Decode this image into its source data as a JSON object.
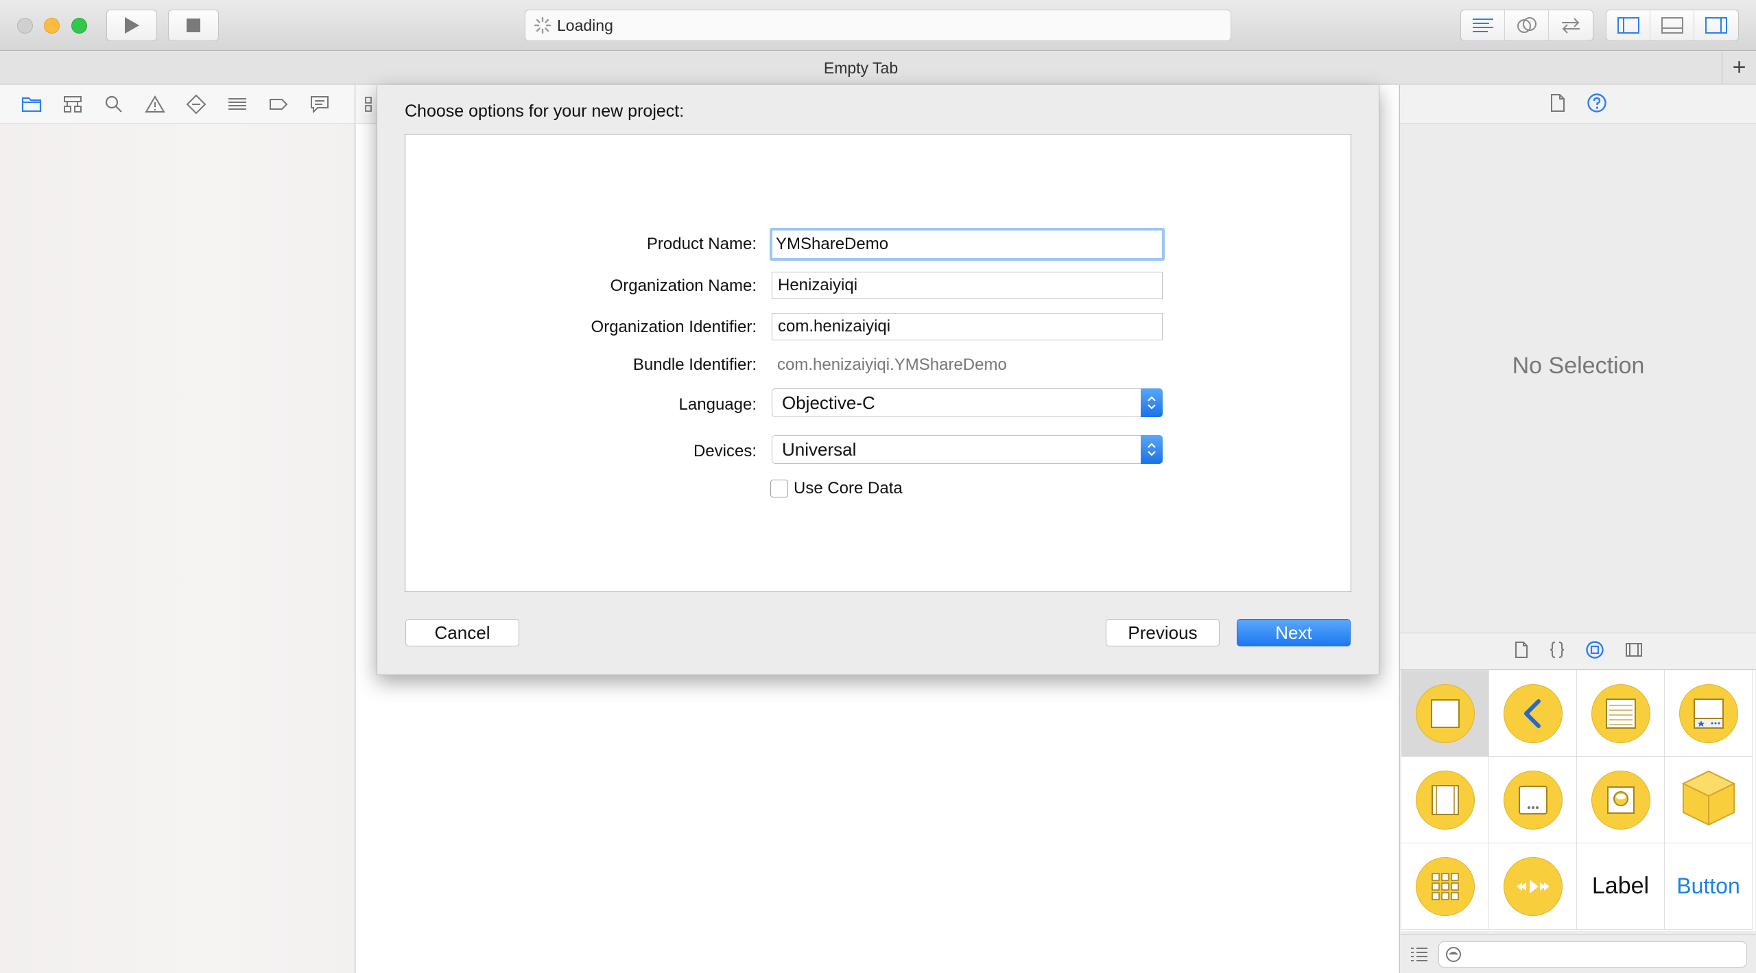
{
  "toolbar": {
    "activity_text": "Loading"
  },
  "tabbar": {
    "title": "Empty Tab",
    "add_label": "+"
  },
  "sheet": {
    "title": "Choose options for your new project:",
    "fields": {
      "product_name_label": "Product Name:",
      "product_name_value": "YMShareDemo",
      "org_name_label": "Organization Name:",
      "org_name_value": "Henizaiyiqi",
      "org_id_label": "Organization Identifier:",
      "org_id_value": "com.henizaiyiqi",
      "bundle_id_label": "Bundle Identifier:",
      "bundle_id_value": "com.henizaiyiqi.YMShareDemo",
      "language_label": "Language:",
      "language_value": "Objective-C",
      "devices_label": "Devices:",
      "devices_value": "Universal",
      "core_data_label": "Use Core Data",
      "core_data_checked": false
    },
    "buttons": {
      "cancel": "Cancel",
      "previous": "Previous",
      "next": "Next"
    }
  },
  "utilities": {
    "no_selection": "No Selection",
    "library_items": [
      {
        "name": "view-controller-icon"
      },
      {
        "name": "navigation-controller-icon"
      },
      {
        "name": "table-view-controller-icon"
      },
      {
        "name": "tab-bar-controller-icon"
      },
      {
        "name": "page-view-controller-icon"
      },
      {
        "name": "glkit-view-controller-icon"
      },
      {
        "name": "avkit-player-icon"
      },
      {
        "name": "object-icon"
      },
      {
        "name": "collection-view-controller-icon"
      },
      {
        "name": "media-player-icon"
      },
      {
        "label": "Label"
      },
      {
        "label": "Button"
      }
    ]
  },
  "colors": {
    "accent": "#1d78f2",
    "library_yellow": "#f8ce3c",
    "focus_ring": "#9cc6f4"
  }
}
